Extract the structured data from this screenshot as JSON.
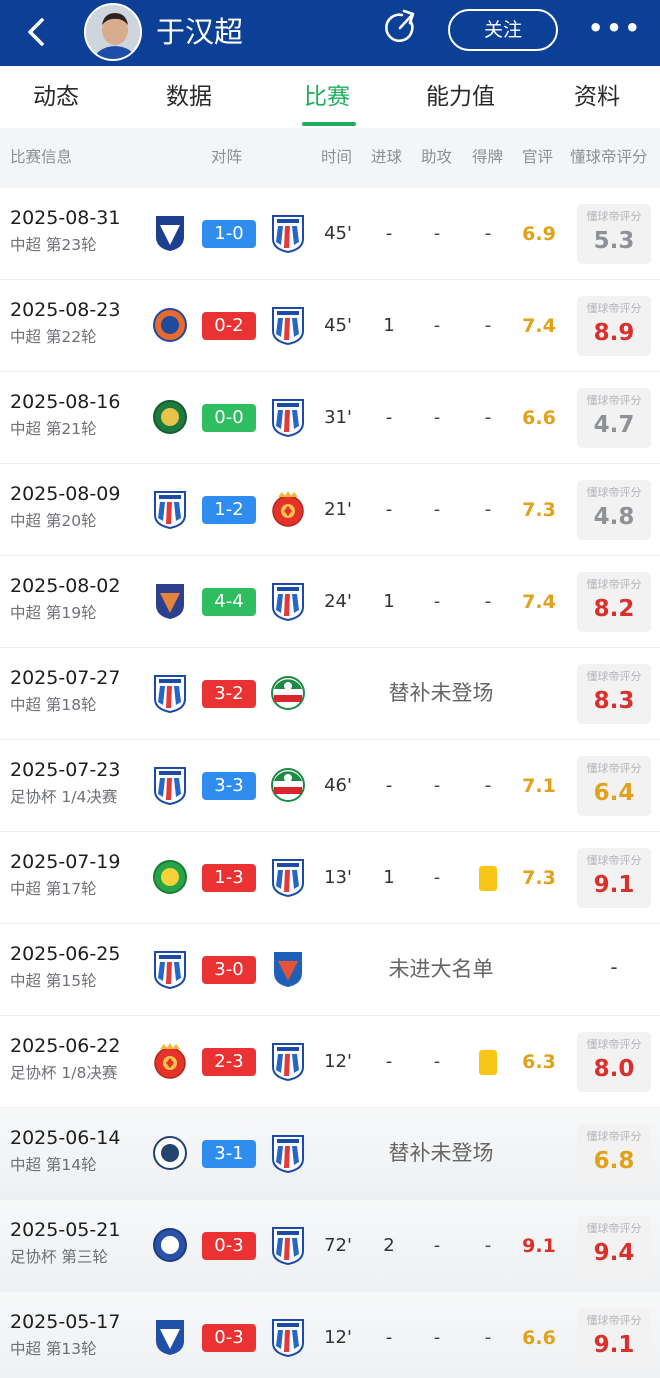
{
  "header": {
    "title": "于汉超",
    "follow_label": "关注",
    "more_label": "•••"
  },
  "tabs": [
    "动态",
    "数据",
    "比赛",
    "能力值",
    "资料"
  ],
  "active_tab": "比赛",
  "columns": {
    "match_info": "比赛信息",
    "fixture": "对阵",
    "minutes": "时间",
    "goals": "进球",
    "assists": "助攻",
    "cards": "得牌",
    "official_rating": "官评",
    "fan_rating": "懂球帝评分"
  },
  "fan_rating_label": "懂球帝评分",
  "colors": {
    "header_bg": "#0c3f96",
    "accent_green": "#1fae5e",
    "score_blue": "#2f8df0",
    "score_red": "#ea3232",
    "score_green": "#2fbd62",
    "rating_gold": "#e0a21b",
    "rating_red": "#d9302c",
    "rating_gray": "#8e9196",
    "yellow_card": "#f7c515"
  },
  "matches": [
    {
      "date": "2025-08-31",
      "competition": "中超 第23轮",
      "home": "meizhou-badge",
      "away": "shenhua-badge",
      "score": "1-0",
      "result": "blue",
      "minutes": "45'",
      "goals": "-",
      "assists": "-",
      "cards": "-",
      "official": "6.9",
      "official_tone": "gold",
      "fan": "5.3",
      "fan_tone": "gray"
    },
    {
      "date": "2025-08-23",
      "competition": "中超 第22轮",
      "home": "meizhou-hakka-badge",
      "away": "shenhua-badge",
      "score": "0-2",
      "result": "red",
      "minutes": "45'",
      "goals": "1",
      "assists": "-",
      "cards": "-",
      "official": "7.4",
      "official_tone": "gold",
      "fan": "8.9",
      "fan_tone": "red"
    },
    {
      "date": "2025-08-16",
      "competition": "中超 第21轮",
      "home": "zhejiang-badge",
      "away": "shenhua-badge",
      "score": "0-0",
      "result": "green",
      "minutes": "31'",
      "goals": "-",
      "assists": "-",
      "cards": "-",
      "official": "6.6",
      "official_tone": "gold",
      "fan": "4.7",
      "fan_tone": "gray"
    },
    {
      "date": "2025-08-09",
      "competition": "中超 第20轮",
      "home": "shenhua-badge",
      "away": "shanghai-port-badge",
      "score": "1-2",
      "result": "blue",
      "minutes": "21'",
      "goals": "-",
      "assists": "-",
      "cards": "-",
      "official": "7.3",
      "official_tone": "gold",
      "fan": "4.8",
      "fan_tone": "gray"
    },
    {
      "date": "2025-08-02",
      "competition": "中超 第19轮",
      "home": "yanbian-badge",
      "away": "shenhua-badge",
      "score": "4-4",
      "result": "green",
      "minutes": "24'",
      "goals": "1",
      "assists": "-",
      "cards": "-",
      "official": "7.4",
      "official_tone": "gold",
      "fan": "8.2",
      "fan_tone": "red"
    },
    {
      "date": "2025-07-27",
      "competition": "中超 第18轮",
      "home": "shenhua-badge",
      "away": "henan-badge",
      "score": "3-2",
      "result": "red",
      "note": "替补未登场",
      "fan": "8.3",
      "fan_tone": "red"
    },
    {
      "date": "2025-07-23",
      "competition": "足协杯 1/4决赛",
      "home": "shenhua-badge",
      "away": "henan-badge",
      "score": "3-3",
      "result": "blue",
      "minutes": "46'",
      "goals": "-",
      "assists": "-",
      "cards": "-",
      "official": "7.1",
      "official_tone": "gold",
      "fan": "6.4",
      "fan_tone": "gold"
    },
    {
      "date": "2025-07-19",
      "competition": "中超 第17轮",
      "home": "beijing-guoan-badge",
      "away": "shenhua-badge",
      "score": "1-3",
      "result": "red",
      "minutes": "13'",
      "goals": "1",
      "assists": "-",
      "cards": "yellow",
      "official": "7.3",
      "official_tone": "gold",
      "fan": "9.1",
      "fan_tone": "red"
    },
    {
      "date": "2025-06-25",
      "competition": "中超 第15轮",
      "home": "shenhua-badge",
      "away": "shenzhen-badge",
      "score": "3-0",
      "result": "red",
      "note": "未进大名单",
      "fan_dash": "-"
    },
    {
      "date": "2025-06-22",
      "competition": "足协杯 1/8决赛",
      "home": "shanghai-port-badge",
      "away": "shenhua-badge",
      "score": "2-3",
      "result": "red",
      "minutes": "12'",
      "goals": "-",
      "assists": "-",
      "cards": "yellow",
      "official": "6.3",
      "official_tone": "gold",
      "fan": "8.0",
      "fan_tone": "red"
    },
    {
      "date": "2025-06-14",
      "competition": "中超 第14轮",
      "home": "chengdu-badge",
      "away": "shenhua-badge",
      "score": "3-1",
      "result": "blue",
      "note": "替补未登场",
      "fan": "6.8",
      "fan_tone": "gold"
    },
    {
      "date": "2025-05-21",
      "competition": "足协杯 第三轮",
      "home": "wuhan-badge",
      "away": "shenhua-badge",
      "score": "0-3",
      "result": "red",
      "minutes": "72'",
      "goals": "2",
      "assists": "-",
      "cards": "-",
      "official": "9.1",
      "official_tone": "red",
      "fan": "9.4",
      "fan_tone": "red"
    },
    {
      "date": "2025-05-17",
      "competition": "中超 第13轮",
      "home": "dalian-badge",
      "away": "shenhua-badge",
      "score": "0-3",
      "result": "red",
      "minutes": "12'",
      "goals": "-",
      "assists": "-",
      "cards": "-",
      "official": "6.6",
      "official_tone": "gold",
      "fan": "9.1",
      "fan_tone": "red"
    }
  ]
}
